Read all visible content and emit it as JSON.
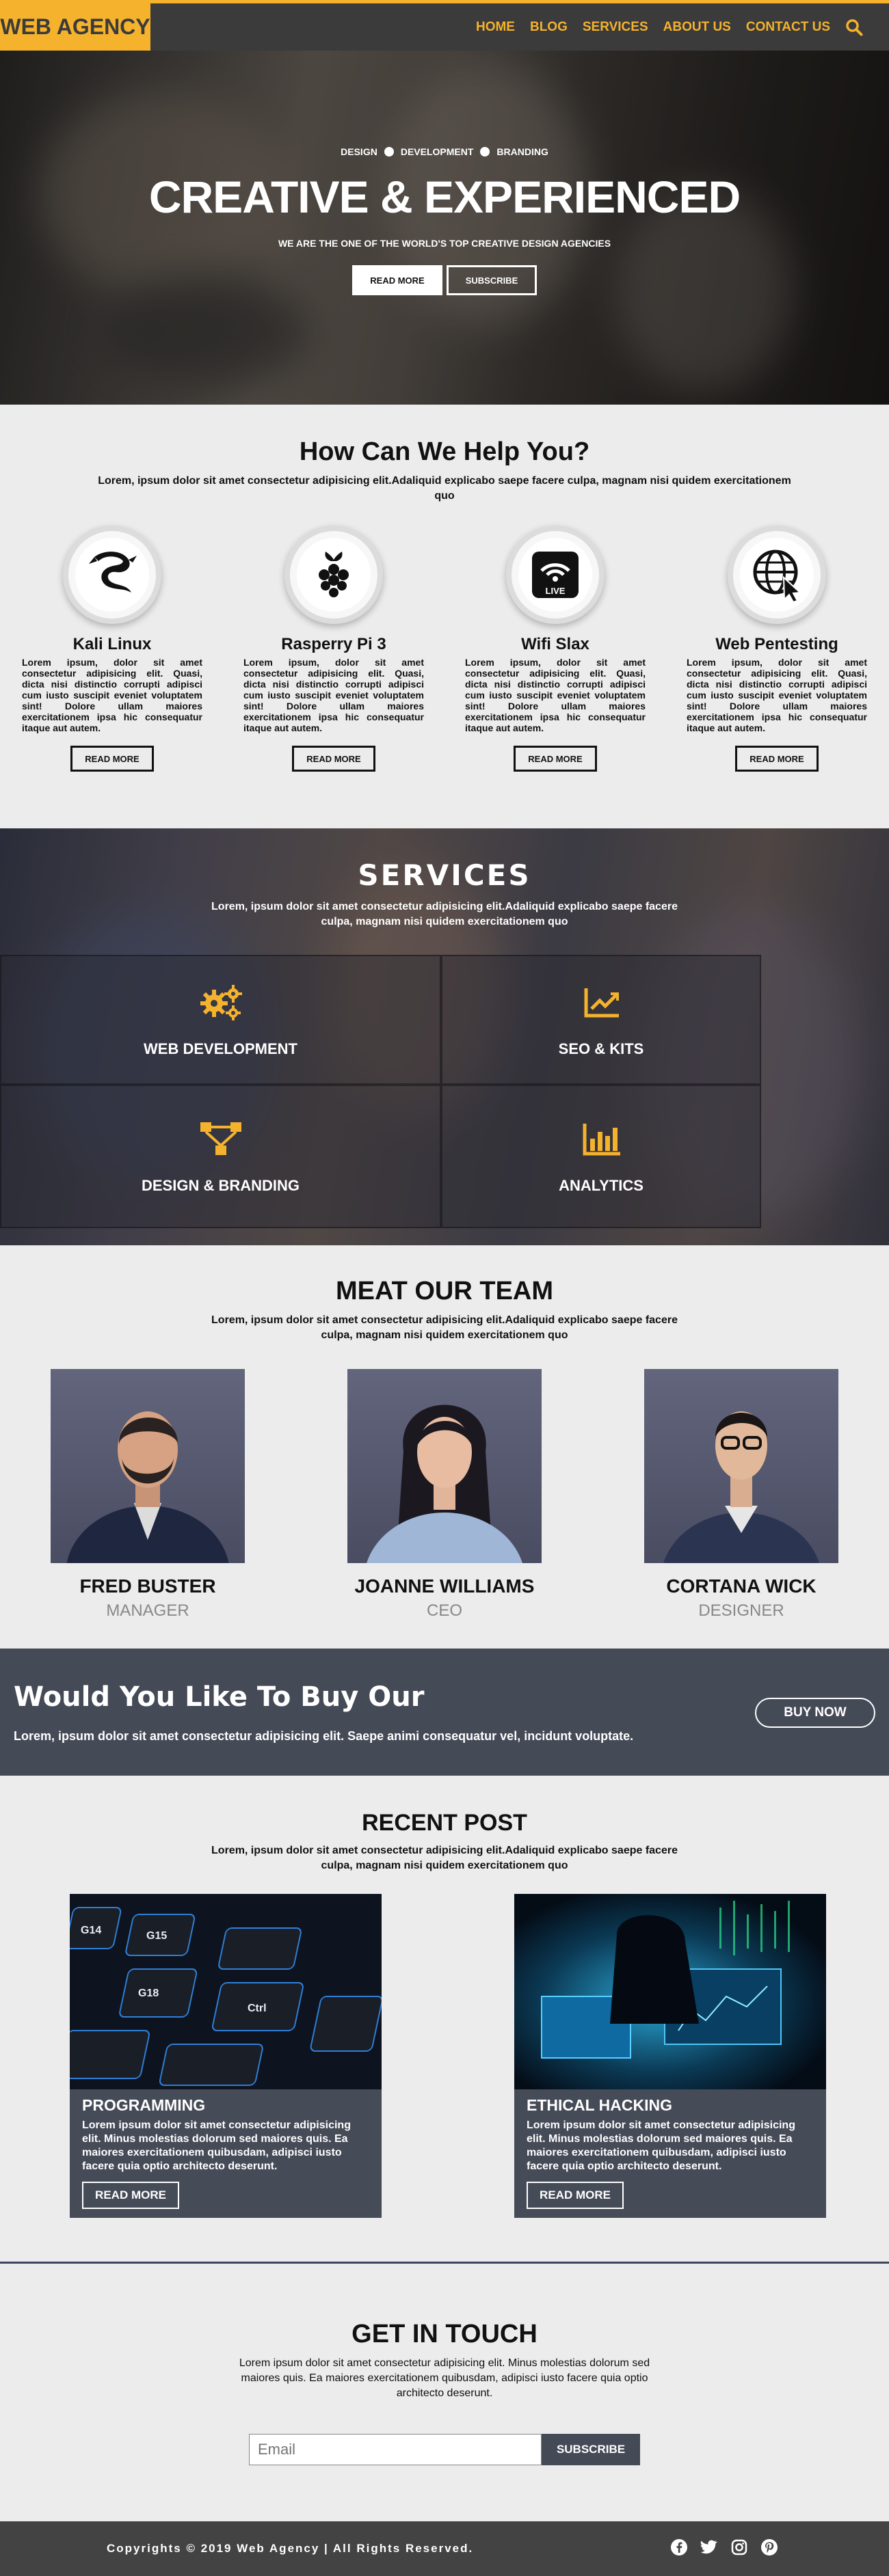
{
  "brand": "WEB AGENCY",
  "nav": {
    "items": [
      "HOME",
      "BLOG",
      "SERVICES",
      "ABOUT US",
      "CONTACT US"
    ]
  },
  "hero": {
    "tags": [
      "DESIGN",
      "DEVELOPMENT",
      "BRANDING"
    ],
    "title": "CREATIVE & EXPERIENCED",
    "subtitle": "WE ARE THE ONE OF THE WORLD'S TOP CREATIVE DESIGN AGENCIES",
    "btn_primary": "READ MORE",
    "btn_secondary": "SUBSCRIBE"
  },
  "help": {
    "title": "How Can We Help You?",
    "desc": "Lorem, ipsum dolor sit amet consectetur adipisicing elit.Adaliquid explicabo saepe facere culpa, magnam nisi quidem exercitationem quo",
    "cards": [
      {
        "title": "Kali Linux",
        "icon": "kali-dragon-icon",
        "text": "Lorem ipsum, dolor sit amet consectetur adipisicing elit. Quasi, dicta nisi distinctio corrupti adipisci cum iusto suscipit eveniet voluptatem sint! Dolore ullam maiores exercitationem ipsa hic consequatur itaque aut autem.",
        "button": "READ MORE"
      },
      {
        "title": "Rasperry Pi 3",
        "icon": "raspberry-pi-icon",
        "text": "Lorem ipsum, dolor sit amet consectetur adipisicing elit. Quasi, dicta nisi distinctio corrupti adipisci cum iusto suscipit eveniet voluptatem sint! Dolore ullam maiores exercitationem ipsa hic consequatur itaque aut autem.",
        "button": "READ MORE"
      },
      {
        "title": "Wifi Slax",
        "icon": "wifi-slax-icon",
        "text": "Lorem ipsum, dolor sit amet consectetur adipisicing elit. Quasi, dicta nisi distinctio corrupti adipisci cum iusto suscipit eveniet voluptatem sint! Dolore ullam maiores exercitationem ipsa hic consequatur itaque aut autem.",
        "button": "READ MORE"
      },
      {
        "title": "Web Pentesting",
        "icon": "globe-cursor-icon",
        "text": "Lorem ipsum, dolor sit amet consectetur adipisicing elit. Quasi, dicta nisi distinctio corrupti adipisci cum iusto suscipit eveniet voluptatem sint! Dolore ullam maiores exercitationem ipsa hic consequatur itaque aut autem.",
        "button": "READ MORE"
      }
    ],
    "wifi_slax_badge": "LIVE"
  },
  "services": {
    "title": "SERVICES",
    "desc": "Lorem, ipsum dolor sit amet consectetur adipisicing elit.Adaliquid explicabo saepe facere culpa, magnam nisi quidem exercitationem quo",
    "items": [
      {
        "label": "WEB DEVELOPMENT",
        "icon": "gears-icon"
      },
      {
        "label": "SEO & KITS",
        "icon": "chart-line-icon"
      },
      {
        "label": "DESIGN & BRANDING",
        "icon": "network-icon"
      },
      {
        "label": "ANALYTICS",
        "icon": "bar-chart-icon"
      }
    ],
    "accent": "#f5b22d"
  },
  "team": {
    "title": "MEAT OUR TEAM",
    "desc": "Lorem, ipsum dolor sit amet consectetur adipisicing elit.Adaliquid explicabo saepe facere culpa, magnam nisi quidem exercitationem quo",
    "members": [
      {
        "name": "FRED BUSTER",
        "role": "MANAGER"
      },
      {
        "name": "JOANNE WILLIAMS",
        "role": "CEO"
      },
      {
        "name": "CORTANA WICK",
        "role": "DESIGNER"
      }
    ]
  },
  "buy": {
    "title": "Would You Like To Buy Our",
    "desc": "Lorem, ipsum dolor sit amet consectetur adipisicing elit. Saepe animi consequatur vel, incidunt voluptate.",
    "button": "BUY NOW"
  },
  "recent": {
    "title": "RECENT POST",
    "desc": "Lorem, ipsum dolor sit amet consectetur adipisicing elit.Adaliquid explicabo saepe facere culpa, magnam nisi quidem exercitationem quo",
    "posts": [
      {
        "title": "PROGRAMMING",
        "text": "Lorem ipsum dolor sit amet consectetur adipisicing elit. Minus molestias dolorum sed maiores quis. Ea maiores exercitationem quibusdam, adipisci iusto facere quia optio architecto deserunt.",
        "button": "READ MORE",
        "keys": [
          "G14",
          "G15",
          "G18",
          "Ctrl"
        ]
      },
      {
        "title": "ETHICAL HACKING",
        "text": "Lorem ipsum dolor sit amet consectetur adipisicing elit. Minus molestias dolorum sed maiores quis. Ea maiores exercitationem quibusdam, adipisci iusto facere quia optio architecto deserunt.",
        "button": "READ MORE"
      }
    ]
  },
  "contact": {
    "title": "GET IN TOUCH",
    "desc": "Lorem ipsum dolor sit amet consectetur adipisicing elit. Minus molestias dolorum sed maiores quis. Ea maiores exercitationem quibusdam, adipisci iusto facere quia optio architecto deserunt.",
    "email_placeholder": "Email",
    "button": "SUBSCRIBE"
  },
  "footer": {
    "copyright": "Copyrights © 2019 Web Agency | All Rights Reserved.",
    "socials": [
      "facebook-icon",
      "twitter-icon",
      "instagram-icon",
      "pinterest-icon"
    ]
  }
}
